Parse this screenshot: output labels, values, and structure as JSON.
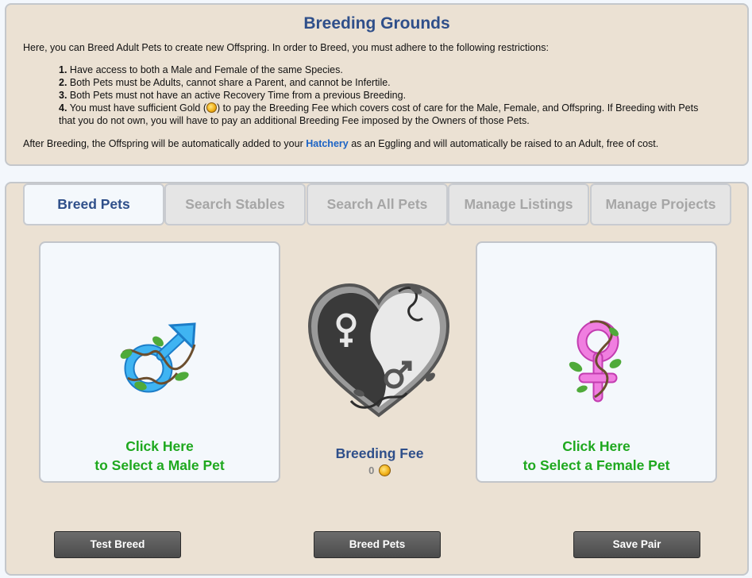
{
  "info": {
    "title": "Breeding Grounds",
    "intro": "Here, you can Breed Adult Pets to create new Offspring. In order to Breed, you must adhere to the following restrictions:",
    "rules": [
      {
        "num": "1.",
        "text": "Have access to both a Male and Female of the same Species."
      },
      {
        "num": "2.",
        "text": "Both Pets must be Adults, cannot share a Parent, and cannot be Infertile."
      },
      {
        "num": "3.",
        "text": "Both Pets must not have an active Recovery Time from a previous Breeding."
      },
      {
        "num": "4.",
        "text_before": "You must have sufficient Gold (",
        "text_after": ") to pay the Breeding Fee which covers cost of care for the Male, Female, and Offspring. If Breeding with Pets that you do not own, you will have to pay an additional Breeding Fee imposed by the Owners of those Pets."
      }
    ],
    "after_before": "After Breeding, the Offspring will be automatically added to your ",
    "after_link": "Hatchery",
    "after_after": " as an Eggling and will automatically be raised to an Adult, free of cost."
  },
  "tabs": [
    {
      "label": "Breed Pets",
      "active": true
    },
    {
      "label": "Search Stables",
      "active": false
    },
    {
      "label": "Search All Pets",
      "active": false
    },
    {
      "label": "Manage Listings",
      "active": false
    },
    {
      "label": "Manage Projects",
      "active": false
    }
  ],
  "male_card": {
    "line1": "Click Here",
    "line2": "to Select a Male Pet",
    "icon": "male-symbol-icon"
  },
  "female_card": {
    "line1": "Click Here",
    "line2": "to Select a Female Pet",
    "icon": "female-symbol-icon"
  },
  "heart_icon": "yin-yang-heart-icon",
  "fee": {
    "label": "Breeding Fee",
    "value": "0",
    "icon": "gold-coin-icon"
  },
  "buttons": {
    "test": "Test Breed",
    "breed": "Breed Pets",
    "save": "Save Pair"
  },
  "colors": {
    "panel_bg": "#ebe1d3",
    "title_blue": "#2f4f8a",
    "link_blue": "#1b63c5",
    "select_green": "#1ea81e",
    "male_blue": "#2a9fe8",
    "female_pink": "#e85fd2",
    "button_gray": "#555555"
  }
}
